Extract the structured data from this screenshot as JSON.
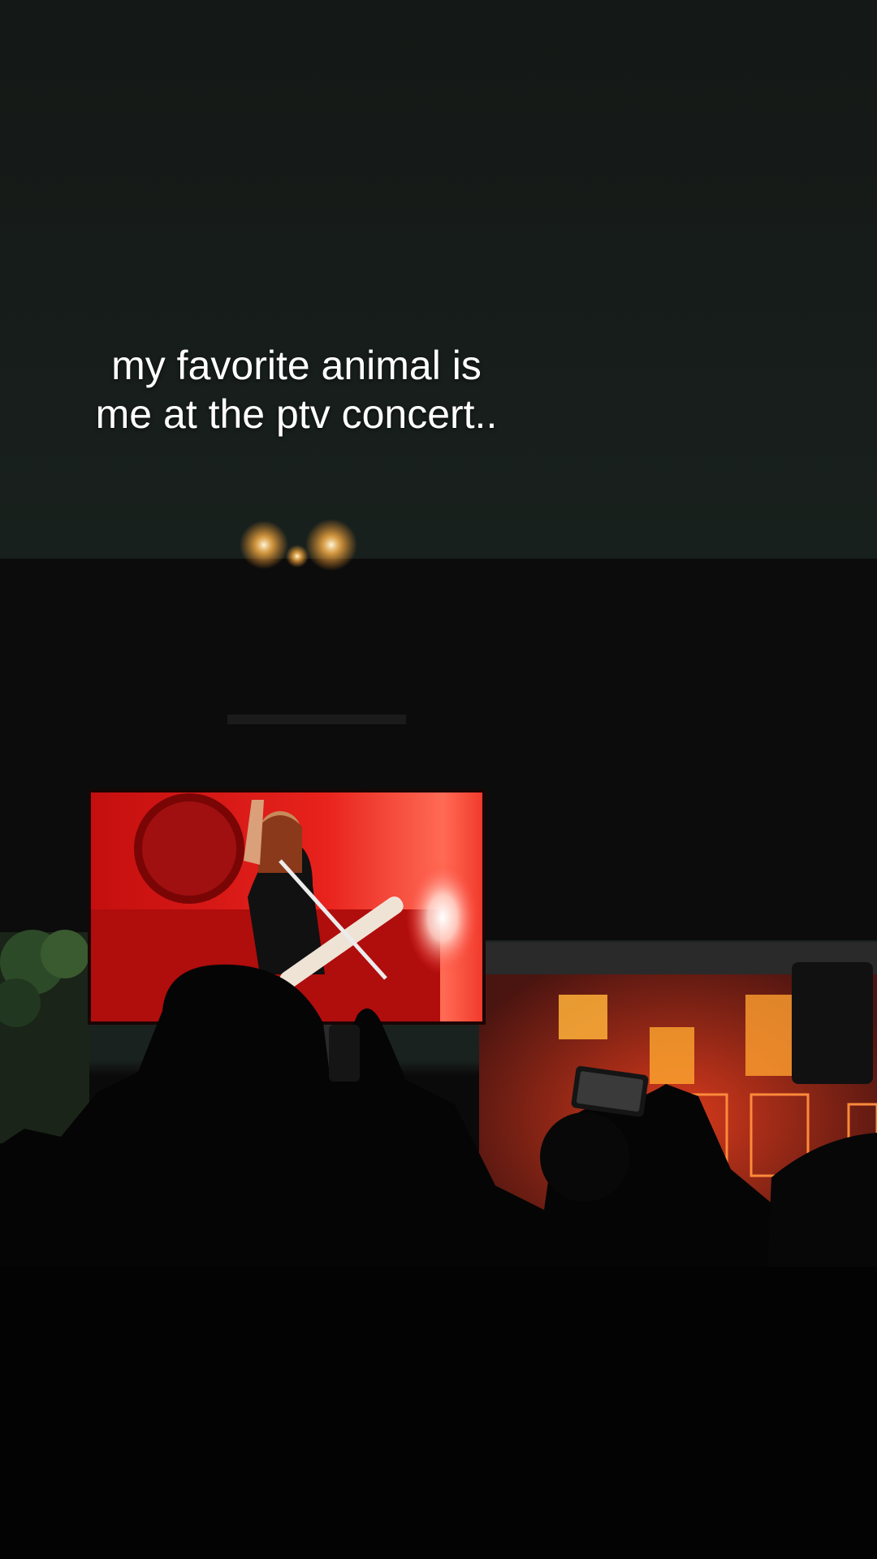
{
  "caption": {
    "line1": "my favorite animal is",
    "line2": "me at the ptv concert.."
  },
  "colors": {
    "sky": "#18201d",
    "stage_red": "#e21a18",
    "crowd": "#050505",
    "caption_text": "#ffffff"
  }
}
